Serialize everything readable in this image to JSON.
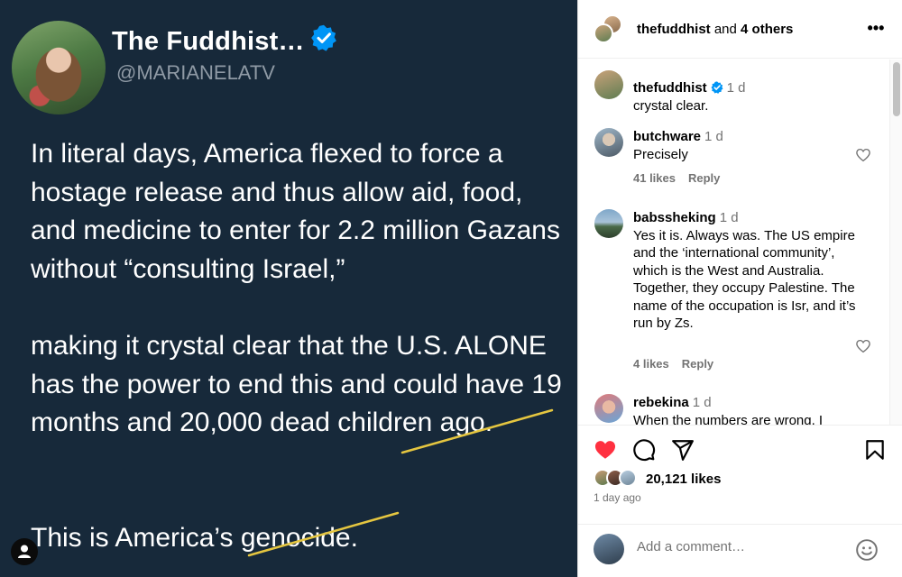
{
  "post": {
    "author_name": "The Fuddhist…",
    "author_handle": "@MARIANELATV",
    "paragraphs": [
      "In literal days, America flexed to force a hostage release and thus allow aid, food, and medicine to enter for 2.2 million Gazans without “consulting Israel,”",
      "making it crystal clear that the U.S. ALONE has the power to end this and could have 19 months and 20,000 dead children ago.",
      "This is America’s genocide."
    ],
    "strike_color": "#e5c640"
  },
  "header": {
    "username": "thefuddhist",
    "connector": " and ",
    "others": "4 others"
  },
  "comments": [
    {
      "user": "thefuddhist",
      "verified": true,
      "time": "1 d",
      "text": "crystal clear."
    },
    {
      "user": "butchware",
      "time": "1 d",
      "text": "Precisely",
      "likes": "41 likes",
      "reply": "Reply"
    },
    {
      "user": "babssheking",
      "time": "1 d",
      "text": "Yes it is. Always was. The US empire and the ‘international community’, which is the West and Australia. Together, they occupy Palestine. The name of the occupation is Isr, and it’s run by Zs.",
      "likes": "4 likes",
      "reply": "Reply"
    },
    {
      "user": "rebekina",
      "time": "1 d",
      "text": "When the numbers are wrong, I"
    }
  ],
  "actions": {
    "likes": "20,121 likes",
    "time": "1 day ago",
    "liked": true,
    "like_color": "#ff3040"
  },
  "composer": {
    "placeholder": "Add a comment…"
  },
  "colors": {
    "background": "#17293a",
    "verified": "#0095f6"
  }
}
